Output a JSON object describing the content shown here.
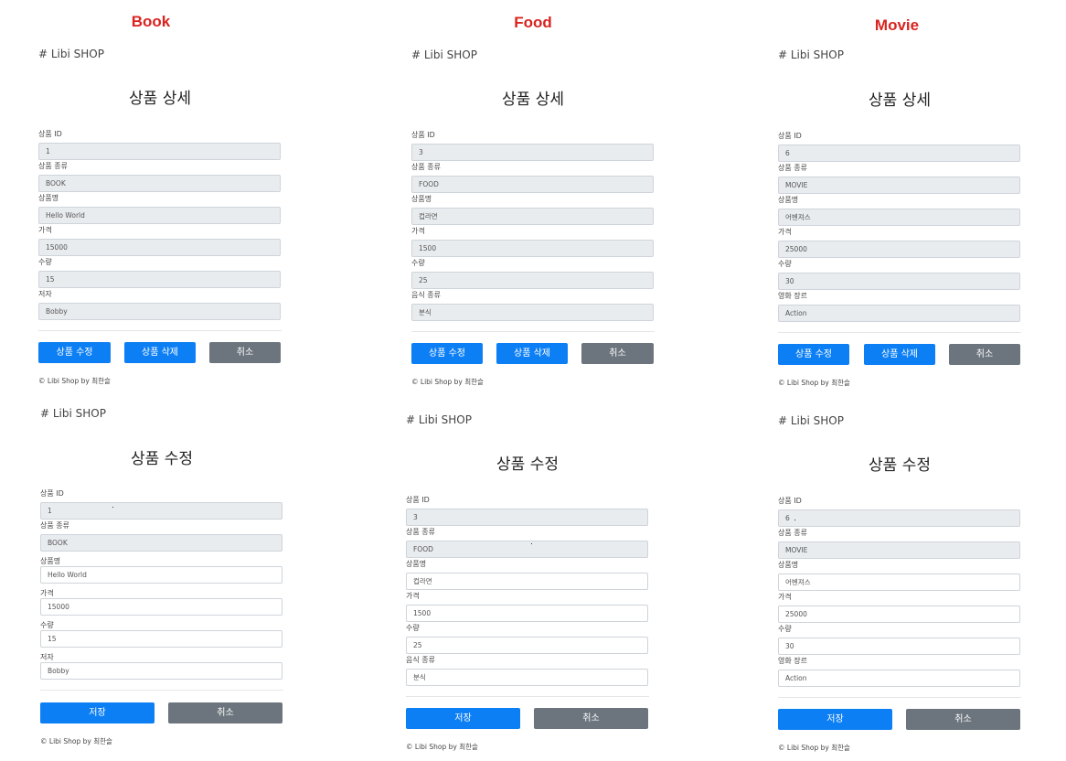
{
  "columns": [
    "Book",
    "Food",
    "Movie"
  ],
  "brand": "# Libi SHOP",
  "detail_title": "상품 상세",
  "edit_title": "상품 수정",
  "footer": "© Libi Shop by 최한슬",
  "buttons": {
    "edit": "상품 수정",
    "delete": "상품 삭제",
    "cancel": "취소",
    "save": "저장"
  },
  "labels": {
    "id": "상품 ID",
    "type": "상품 종류",
    "name": "상품명",
    "price": "가격",
    "quantity": "수량",
    "author": "저자",
    "food_type": "음식 종류",
    "genre": "영화 장르"
  },
  "book": {
    "id": "1",
    "type": "BOOK",
    "name": "Hello World",
    "price": "15000",
    "quantity": "15",
    "extra": "Bobby"
  },
  "food": {
    "id": "3",
    "type": "FOOD",
    "name": "컵라면",
    "price": "1500",
    "quantity": "25",
    "extra": "분식"
  },
  "movie": {
    "id": "6",
    "type": "MOVIE",
    "name": "어벤져스",
    "price": "25000",
    "quantity": "30",
    "extra": "Action"
  }
}
